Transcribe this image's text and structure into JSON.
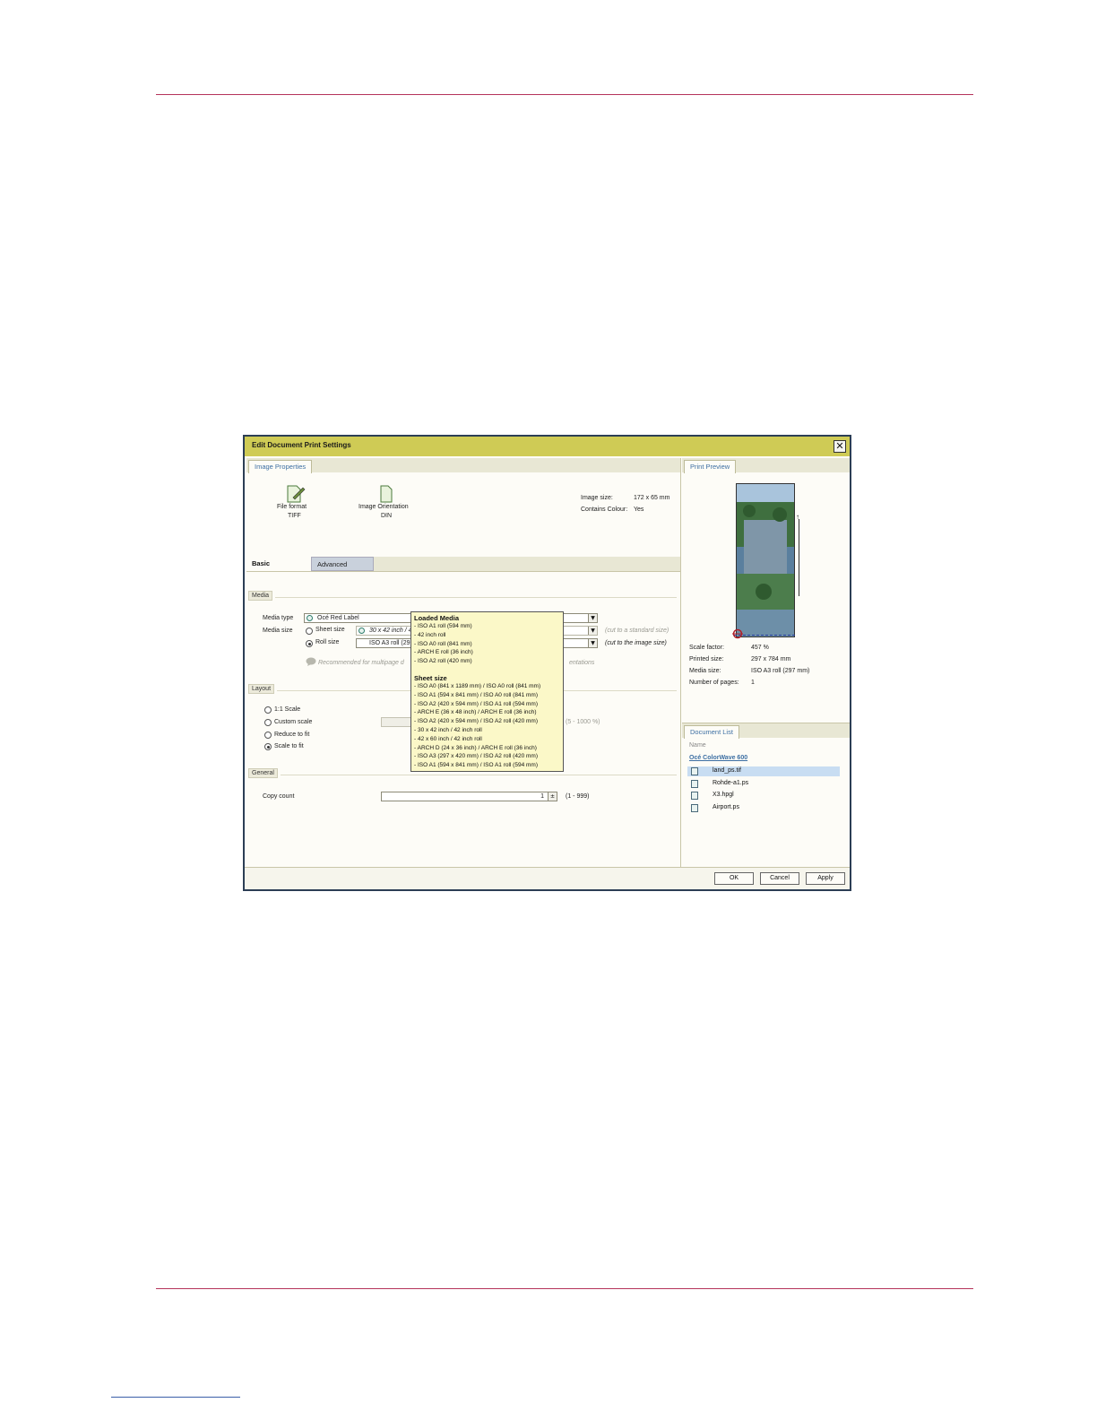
{
  "dialog": {
    "title": "Edit Document Print Settings",
    "close_label": "✕"
  },
  "image_properties": {
    "tab_label": "Image Properties",
    "file_format_label": "File format",
    "file_format_value": "TIFF",
    "orientation_label": "Image Orientation",
    "orientation_value": "DIN",
    "image_size_label": "Image size:",
    "image_size_value": "172 x 65 mm",
    "contains_colour_label": "Contains Colour:",
    "contains_colour_value": "Yes"
  },
  "tabs": {
    "basic": "Basic",
    "advanced": "Advanced"
  },
  "media": {
    "section": "Media",
    "media_type_label": "Media type",
    "media_type_value": "Océ Red Label",
    "media_size_label": "Media size",
    "sheet_size_label": "Sheet size",
    "sheet_size_value": "30 x 42 inch / 42 inch roll",
    "sheet_size_note": "(cut to a standard size)",
    "roll_size_label": "Roll size",
    "roll_size_value": "ISO A3 roll (297 mm)",
    "roll_size_note": "(cut to the image size)",
    "recommendation_start": "Recommended for multipage d",
    "recommendation_end": "entations"
  },
  "layout": {
    "section": "Layout",
    "scale_1_1": "1:1 Scale",
    "custom_scale": "Custom scale",
    "custom_range": "(5 - 1000 %)",
    "reduce_to_fit": "Reduce to fit",
    "scale_to_fit": "Scale to fit"
  },
  "general": {
    "section": "General",
    "copy_count_label": "Copy count",
    "copy_count_value": "1",
    "copy_range": "(1 - 999)"
  },
  "popup": {
    "loaded_header": "Loaded Media",
    "loaded_items": [
      "- ISO A1 roll (594 mm)",
      "- 42 inch roll",
      "- ISO A0 roll (841 mm)",
      "- ARCH E roll (36 inch)",
      "- ISO A2 roll (420 mm)"
    ],
    "sheet_header": "Sheet size",
    "sheet_items": [
      "- ISO A0 (841 x 1189 mm) / ISO A0 roll (841 mm)",
      "- ISO A1 (594 x 841 mm) / ISO A0 roll (841 mm)",
      "- ISO A2 (420 x 594 mm) / ISO A1 roll (594 mm)",
      "- ARCH E (36 x 48 inch) / ARCH E roll (36 inch)",
      "- ISO A2 (420 x 594 mm) / ISO A2 roll (420 mm)",
      "- 30 x 42 inch / 42 inch roll",
      "- 42 x 60 inch / 42 inch roll",
      "- ARCH D (24 x 36 inch) / ARCH E roll (36 inch)",
      "- ISO A3 (297 x 420 mm) / ISO A2 roll (420 mm)",
      "- ISO A1 (594 x 841 mm) / ISO A1 roll (594 mm)"
    ]
  },
  "print_preview": {
    "tab_label": "Print Preview",
    "scale_factor_label": "Scale factor:",
    "scale_factor_value": "457 %",
    "printed_size_label": "Printed size:",
    "printed_size_value": "297 x 784 mm",
    "media_size_label": "Media size:",
    "media_size_value": "ISO A3 roll (297 mm)",
    "pages_label": "Number of pages:",
    "pages_value": "1"
  },
  "document_list": {
    "tab_label": "Document List",
    "name_header": "Name",
    "printer": "Océ ColorWave 600",
    "documents": [
      "land_ps.tif",
      "Rohde-a1.ps",
      "X3.hpgl",
      "Airport.ps"
    ]
  },
  "buttons": {
    "ok": "OK",
    "cancel": "Cancel",
    "apply": "Apply"
  },
  "colors": {
    "titlebar": "#cfcb55",
    "accent_link": "#3d6fa3",
    "rule": "#b5335a"
  }
}
